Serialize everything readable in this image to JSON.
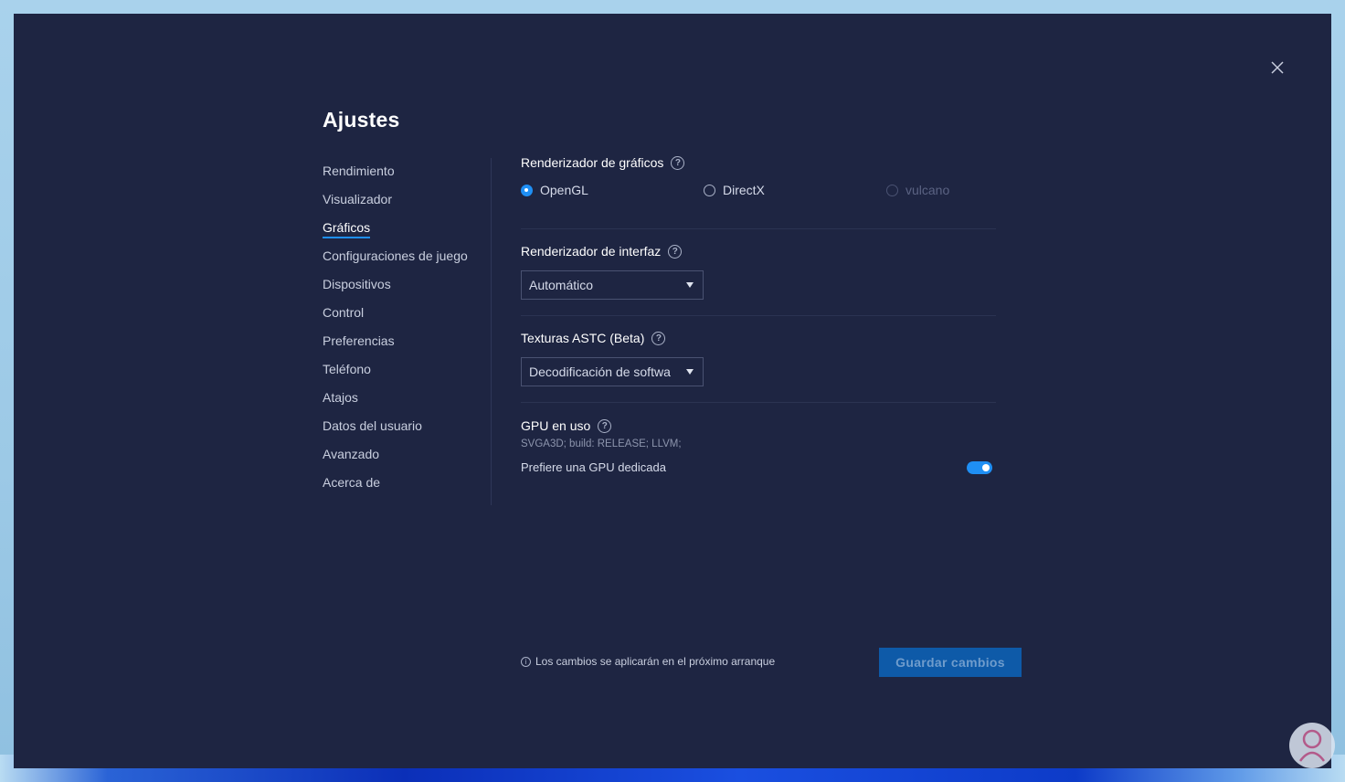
{
  "window": {
    "title": "Ajustes"
  },
  "sidebar": {
    "items": [
      {
        "label": "Rendimiento"
      },
      {
        "label": "Visualizador"
      },
      {
        "label": "Gráficos",
        "active": true
      },
      {
        "label": "Configuraciones de juego"
      },
      {
        "label": "Dispositivos"
      },
      {
        "label": "Control"
      },
      {
        "label": "Preferencias"
      },
      {
        "label": "Teléfono"
      },
      {
        "label": "Atajos"
      },
      {
        "label": "Datos del usuario"
      },
      {
        "label": "Avanzado"
      },
      {
        "label": "Acerca de"
      }
    ]
  },
  "graphics_renderer": {
    "title": "Renderizador de gráficos",
    "options": [
      {
        "label": "OpenGL",
        "checked": true,
        "disabled": false
      },
      {
        "label": "DirectX",
        "checked": false,
        "disabled": false
      },
      {
        "label": "vulcano",
        "checked": false,
        "disabled": true
      }
    ]
  },
  "interface_renderer": {
    "title": "Renderizador de interfaz",
    "selected": "Automático"
  },
  "astc": {
    "title": "Texturas ASTC (Beta)",
    "selected": "Decodificación de softwa"
  },
  "gpu": {
    "title": "GPU en uso",
    "info": "SVGA3D; build: RELEASE;  LLVM;",
    "prefer_label": "Prefiere una GPU dedicada",
    "prefer_enabled": true
  },
  "footer": {
    "note": "Los cambios se aplicarán en el próximo arranque",
    "save_label": "Guardar cambios"
  },
  "colors": {
    "background": "#1e2542",
    "accent": "#1f8ff4",
    "save_button": "#0e5aa8"
  }
}
